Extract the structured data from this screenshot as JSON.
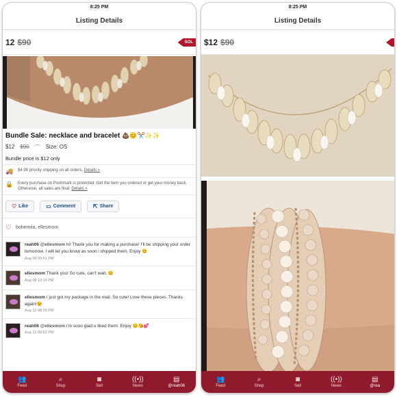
{
  "status": {
    "time": "8:25 PM"
  },
  "nav": {
    "title": "Listing Details"
  },
  "price": {
    "current": "$12",
    "original": "$90",
    "left_current": "12",
    "ribbon": "SOLD",
    "ribbon_visible": "SOL"
  },
  "listing": {
    "title": "Bundle Sale: necklace and bracelet",
    "title_emoji": "💩😊✂️✨✨",
    "price_current": "$12",
    "price_original": "$90",
    "size": "Size: OS",
    "description": "Bundle price is $12 only",
    "shipping_text": "$4.99 priority shipping on all orders.",
    "protection_text": "Every purchase on Poshmark is protected. Get the item you ordered or get your money back. Otherwise, all sales are final.",
    "details_link": "Details »"
  },
  "actions": {
    "like": "Like",
    "comment": "Comment",
    "share": "Share"
  },
  "likers": "bohemiia, ellesmom",
  "comments": [
    {
      "user": "reah06",
      "mention": "@ellesmom",
      "text": "hi! Thank you for making a purchase! I'll be shipping your order tomorrow. I will let you know as soon i shipped them. Enjoy 😊",
      "date": "Aug 08 09:51 PM"
    },
    {
      "user": "ellesmom",
      "mention": "",
      "text": "Thank you! So cute, can't wait. 😊",
      "date": "Aug 08 10:14 PM"
    },
    {
      "user": "ellesmom",
      "mention": "",
      "text": "I just got my package in the mail. So cute! Love these pieces. Thanks again!😉",
      "date": "Aug 12 08:29 PM"
    },
    {
      "user": "reah06",
      "mention": "@ellesmom",
      "text": "i'm sooo glad u liked them. Enjoy 😊😘💕",
      "date": "Aug 12 09:52 PM"
    }
  ],
  "tabs": {
    "feed": "Feed",
    "shop": "Shop",
    "sell": "Sell",
    "news": "News",
    "me_left": "@reah06",
    "me_right": "@rea"
  },
  "icons": {
    "feed": "people-icon",
    "shop": "search-icon",
    "sell": "camera-icon",
    "news": "broadcast-icon",
    "me": "id-card-icon"
  },
  "colors": {
    "brand": "#8e1a2b",
    "ribbon": "#b0152a",
    "link": "#1a4f8a"
  }
}
